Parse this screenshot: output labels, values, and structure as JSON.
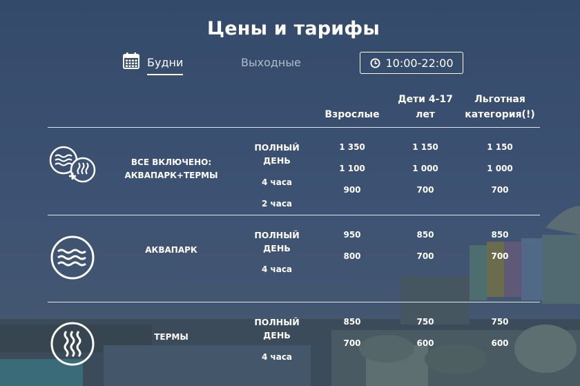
{
  "title": "Цены и тарифы",
  "tabs": {
    "weekdays": "Будни",
    "weekends": "Выходные",
    "active": "weekdays"
  },
  "hours": "10:00-22:00",
  "columns": {
    "adults": "Взрослые",
    "kids_line1": "Дети 4-17",
    "kids_line2": "лет",
    "discount_line1": "Льготная",
    "discount_line2": "категория(!)"
  },
  "icons": {
    "calendar": "calendar-icon",
    "clock": "clock-icon",
    "combo": "waves-plus-heat-icon",
    "aquapark": "waves-icon",
    "thermal": "heat-waves-icon"
  },
  "services": [
    {
      "name_line1": "ВСЕ ВКЛЮЧЕНО:",
      "name_line2": "АКВАПАРК+ТЕРМЫ",
      "full_day_line1": "ПОЛНЫЙ",
      "full_day_line2": "ДЕНЬ",
      "durations": [
        "4 часа",
        "2 часа"
      ],
      "prices": [
        {
          "adults": "1 350",
          "kids": "1 150",
          "discount": "1 150"
        },
        {
          "adults": "1 100",
          "kids": "1 000",
          "discount": "1 000"
        },
        {
          "adults": "900",
          "kids": "700",
          "discount": "700"
        }
      ]
    },
    {
      "name_line1": "АКВАПАРК",
      "full_day_line1": "ПОЛНЫЙ",
      "full_day_line2": "ДЕНЬ",
      "durations": [
        "4 часа"
      ],
      "prices": [
        {
          "adults": "950",
          "kids": "850",
          "discount": "850"
        },
        {
          "adults": "800",
          "kids": "700",
          "discount": "700"
        }
      ]
    },
    {
      "name_line1": "ТЕРМЫ",
      "full_day_line1": "ПОЛНЫЙ",
      "full_day_line2": "ДЕНЬ",
      "durations": [
        "4 часа"
      ],
      "prices": [
        {
          "adults": "850",
          "kids": "750",
          "discount": "750"
        },
        {
          "adults": "700",
          "kids": "600",
          "discount": "600"
        }
      ]
    }
  ]
}
